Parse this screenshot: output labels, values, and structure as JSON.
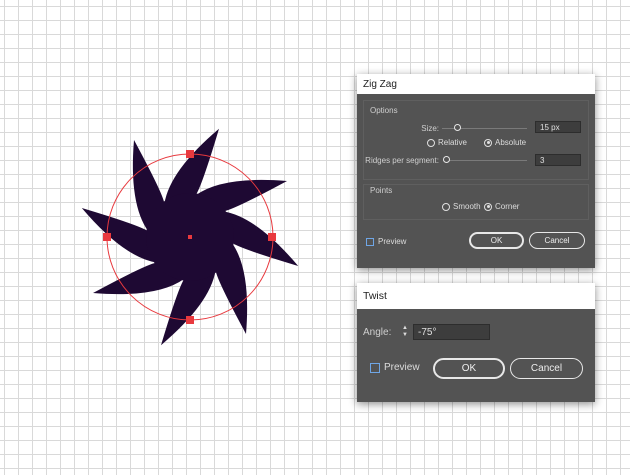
{
  "zigzag": {
    "title": "Zig Zag",
    "options_label": "Options",
    "size_label": "Size:",
    "size_value": "15 px",
    "size_slider_level": 0.05,
    "relative_label": "Relative",
    "absolute_label": "Absolute",
    "ridges_label": "Ridges per segment:",
    "ridges_value": "3",
    "ridges_slider_level": 0.02,
    "points_label": "Points",
    "smooth_label": "Smooth",
    "corner_label": "Corner",
    "preview_label": "Preview",
    "preview_checked": false,
    "ok_label": "OK",
    "cancel_label": "Cancel",
    "selected_displacement": "Absolute",
    "selected_points": "Corner"
  },
  "twist": {
    "title": "Twist",
    "angle_label": "Angle:",
    "angle_value": "-75°",
    "preview_label": "Preview",
    "preview_checked": false,
    "ok_label": "OK",
    "cancel_label": "Cancel"
  },
  "artwork": {
    "shape_color": "#1e0933",
    "circle_color": "#e8393e",
    "handle_color": "#e8393e",
    "arm_count": 8,
    "twist_angle": -75
  },
  "theme": {
    "dialog_bg": "#535353",
    "canvas_bg": "#ffffff",
    "grid_color": "#d9d9d9"
  }
}
